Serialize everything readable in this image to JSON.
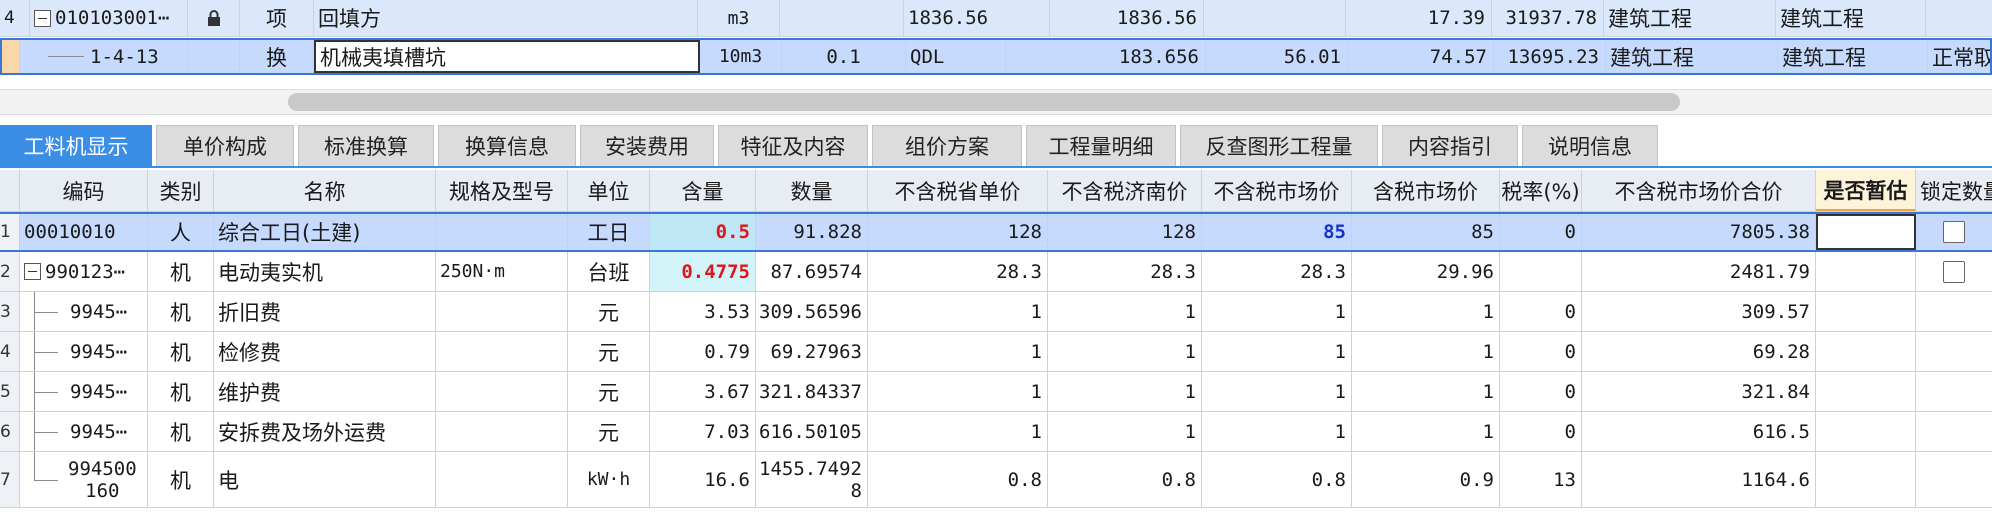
{
  "upper": {
    "rows": [
      {
        "rownum": "4",
        "code": "010103001⋯",
        "type": "项",
        "name": "回填方",
        "unit": "m3",
        "qty": "",
        "qty2": "1836.56",
        "qty3": "1836.56",
        "price1": "",
        "price2": "17.39",
        "total": "31937.78",
        "cat1": "建筑工程",
        "cat2": "建筑工程",
        "extra": ""
      },
      {
        "rownum": "",
        "code": "1-4-13",
        "type": "换",
        "name": "机械夷填槽坑",
        "unit": "10m3",
        "qty": "0.1",
        "qty2": "QDL",
        "qty3": "183.656",
        "price1": "56.01",
        "price2": "74.57",
        "total": "13695.23",
        "cat1": "建筑工程",
        "cat2": "建筑工程",
        "extra": "正常取"
      }
    ]
  },
  "tabs": [
    {
      "label": "工料机显示",
      "active": true
    },
    {
      "label": "单价构成"
    },
    {
      "label": "标准换算"
    },
    {
      "label": "换算信息"
    },
    {
      "label": "安装费用"
    },
    {
      "label": "特征及内容"
    },
    {
      "label": "组价方案"
    },
    {
      "label": "工程量明细"
    },
    {
      "label": "反查图形工程量"
    },
    {
      "label": "内容指引"
    },
    {
      "label": "说明信息"
    }
  ],
  "lower": {
    "headers": [
      "编码",
      "类别",
      "名称",
      "规格及型号",
      "单位",
      "含量",
      "数量",
      "不含税省单价",
      "不含税济南价",
      "不含税市场价",
      "含税市场价",
      "税率(%)",
      "不含税市场价合价",
      "是否暂估",
      "锁定数量"
    ],
    "rows": [
      {
        "n": "1",
        "code": "00010010",
        "type": "人",
        "name": "综合工日(土建)",
        "spec": "",
        "unit": "工日",
        "content": "0.5",
        "qty": "91.828",
        "p1": "128",
        "p2": "128",
        "p3": "85",
        "p4": "85",
        "tax": "0",
        "total": "7805.38"
      },
      {
        "n": "2",
        "code": "990123⋯",
        "type": "机",
        "name": "电动夷实机",
        "spec": "250N·m",
        "unit": "台班",
        "content": "0.4775",
        "qty": "87.69574",
        "p1": "28.3",
        "p2": "28.3",
        "p3": "28.3",
        "p4": "29.96",
        "tax": "",
        "total": "2481.79"
      },
      {
        "n": "3",
        "code": "9945⋯",
        "type": "机",
        "name": "折旧费",
        "spec": "",
        "unit": "元",
        "content": "3.53",
        "qty": "309.56596",
        "p1": "1",
        "p2": "1",
        "p3": "1",
        "p4": "1",
        "tax": "0",
        "total": "309.57"
      },
      {
        "n": "4",
        "code": "9945⋯",
        "type": "机",
        "name": "检修费",
        "spec": "",
        "unit": "元",
        "content": "0.79",
        "qty": "69.27963",
        "p1": "1",
        "p2": "1",
        "p3": "1",
        "p4": "1",
        "tax": "0",
        "total": "69.28"
      },
      {
        "n": "5",
        "code": "9945⋯",
        "type": "机",
        "name": "维护费",
        "spec": "",
        "unit": "元",
        "content": "3.67",
        "qty": "321.84337",
        "p1": "1",
        "p2": "1",
        "p3": "1",
        "p4": "1",
        "tax": "0",
        "total": "321.84"
      },
      {
        "n": "6",
        "code": "9945⋯",
        "type": "机",
        "name": "安拆费及场外运费",
        "spec": "",
        "unit": "元",
        "content": "7.03",
        "qty": "616.50105",
        "p1": "1",
        "p2": "1",
        "p3": "1",
        "p4": "1",
        "tax": "0",
        "total": "616.5"
      },
      {
        "n": "7",
        "code": "994500",
        "code2": "160",
        "type": "机",
        "name": "电",
        "spec": "",
        "unit": "kW·h",
        "content": "16.6",
        "qty": "1455.7492",
        "qty2": "8",
        "p1": "0.8",
        "p2": "0.8",
        "p3": "0.8",
        "p4": "0.9",
        "tax": "13",
        "total": "1164.6"
      }
    ]
  }
}
